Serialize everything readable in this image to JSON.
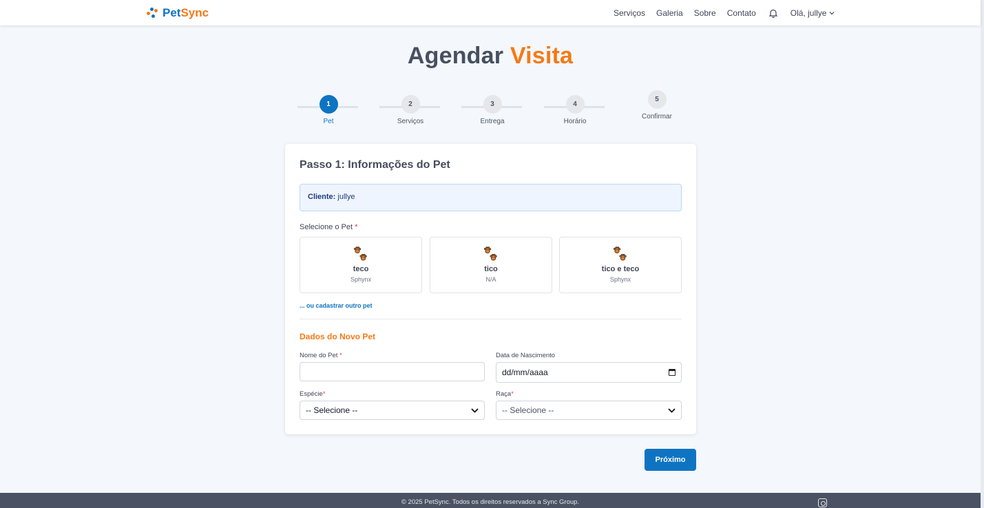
{
  "header": {
    "brand_first": "Pet",
    "brand_second": "Sync",
    "nav": [
      "Serviços",
      "Galeria",
      "Sobre",
      "Contato"
    ],
    "user_greeting": "Olá, jullye"
  },
  "title": {
    "first": "Agendar",
    "second": "Visita"
  },
  "stepper": [
    {
      "number": "1",
      "label": "Pet"
    },
    {
      "number": "2",
      "label": "Serviços"
    },
    {
      "number": "3",
      "label": "Entrega"
    },
    {
      "number": "4",
      "label": "Horário"
    },
    {
      "number": "5",
      "label": "Confirmar"
    }
  ],
  "card": {
    "heading": "Passo 1: Informações do Pet",
    "client_label": "Cliente:",
    "client_value": "jullye",
    "select_pet_label": "Selecione o Pet",
    "required_mark": "*",
    "pets": [
      {
        "name": "teco",
        "breed": "Sphynx"
      },
      {
        "name": "tico",
        "breed": "N/A"
      },
      {
        "name": "tico e teco",
        "breed": "Sphynx"
      }
    ],
    "other_pet_link": "... ou cadastrar outro pet",
    "new_pet_title": "Dados do Novo Pet",
    "fields": {
      "name_label": "Nome do Pet",
      "name_value": "",
      "birth_label": "Data de Nascimento",
      "birth_value": "dd/mm/aaaa",
      "species_label": "Espécie",
      "species_value": "-- Selecione --",
      "breed_label": "Raça",
      "breed_value": "-- Selecione --"
    }
  },
  "next_button": "Próximo",
  "footer": {
    "copyright": "© 2025 PetSync. Todos os direitos reservados a Sync Group."
  },
  "colors": {
    "primary": "#0e74c2",
    "accent": "#f47a17",
    "footer_bg": "#4a5263"
  }
}
